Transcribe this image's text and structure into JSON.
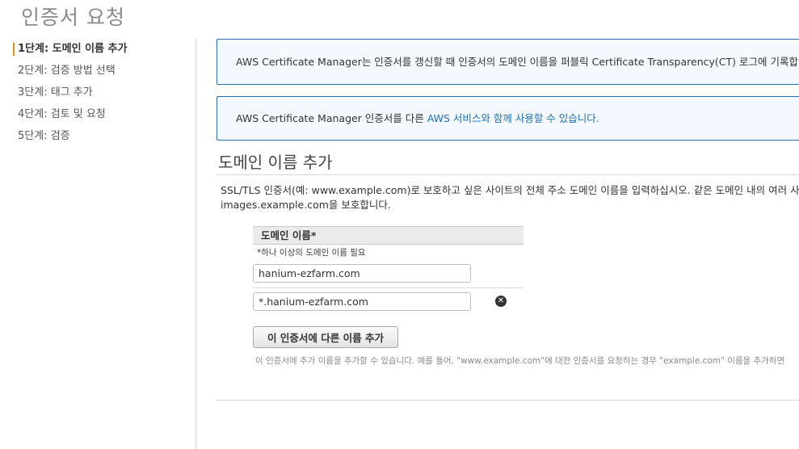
{
  "page": {
    "title": "인증서 요청"
  },
  "steps": [
    {
      "label": "1단계: 도메인 이름 추가",
      "active": true
    },
    {
      "label": "2단계: 검증 방법 선택"
    },
    {
      "label": "3단계: 태그 추가"
    },
    {
      "label": "4단계: 검토 및 요청"
    },
    {
      "label": "5단계: 검증"
    }
  ],
  "info": {
    "box1_text": "AWS Certificate Manager는 인증서를 갱신할 때 인증서의 도메인 이름을 퍼블릭 Certificate Transparency(CT) 로그에 기록합니다",
    "box2_prefix": "AWS Certificate Manager 인증서를 다른 ",
    "box2_link": "AWS 서비스와 함께 사용할 수 있습니다."
  },
  "section": {
    "title": "도메인 이름 추가",
    "description_line1": "SSL/TLS 인증서(예: www.example.com)로 보호하고 싶은 사이트의 전체 주소 도메인 이름을 입력하십시오. 같은 도메인 내의 여러 사이트를 보호하려면",
    "description_line2": "images.example.com을 보호합니다."
  },
  "domain_field": {
    "header": "도메인 이름*",
    "hint": "*하나 이상의 도메인 이름 필요",
    "values": [
      "hanium-ezfarm.com",
      "*.hanium-ezfarm.com"
    ],
    "remove_symbol": "✕"
  },
  "add_button_label": "이 인증서에 다른 이름 추가",
  "help_text": "이 인증서에 추가 이름을 추가할 수 있습니다. 예를 들어, \"www.example.com\"에 대한 인증서를 요청하는 경우 \"example.com\" 이름을 추가하면",
  "colors": {
    "accent": "#e49013",
    "info_border": "#2a6fa3",
    "info_bg": "#f3f9ff",
    "link": "#226fad"
  }
}
